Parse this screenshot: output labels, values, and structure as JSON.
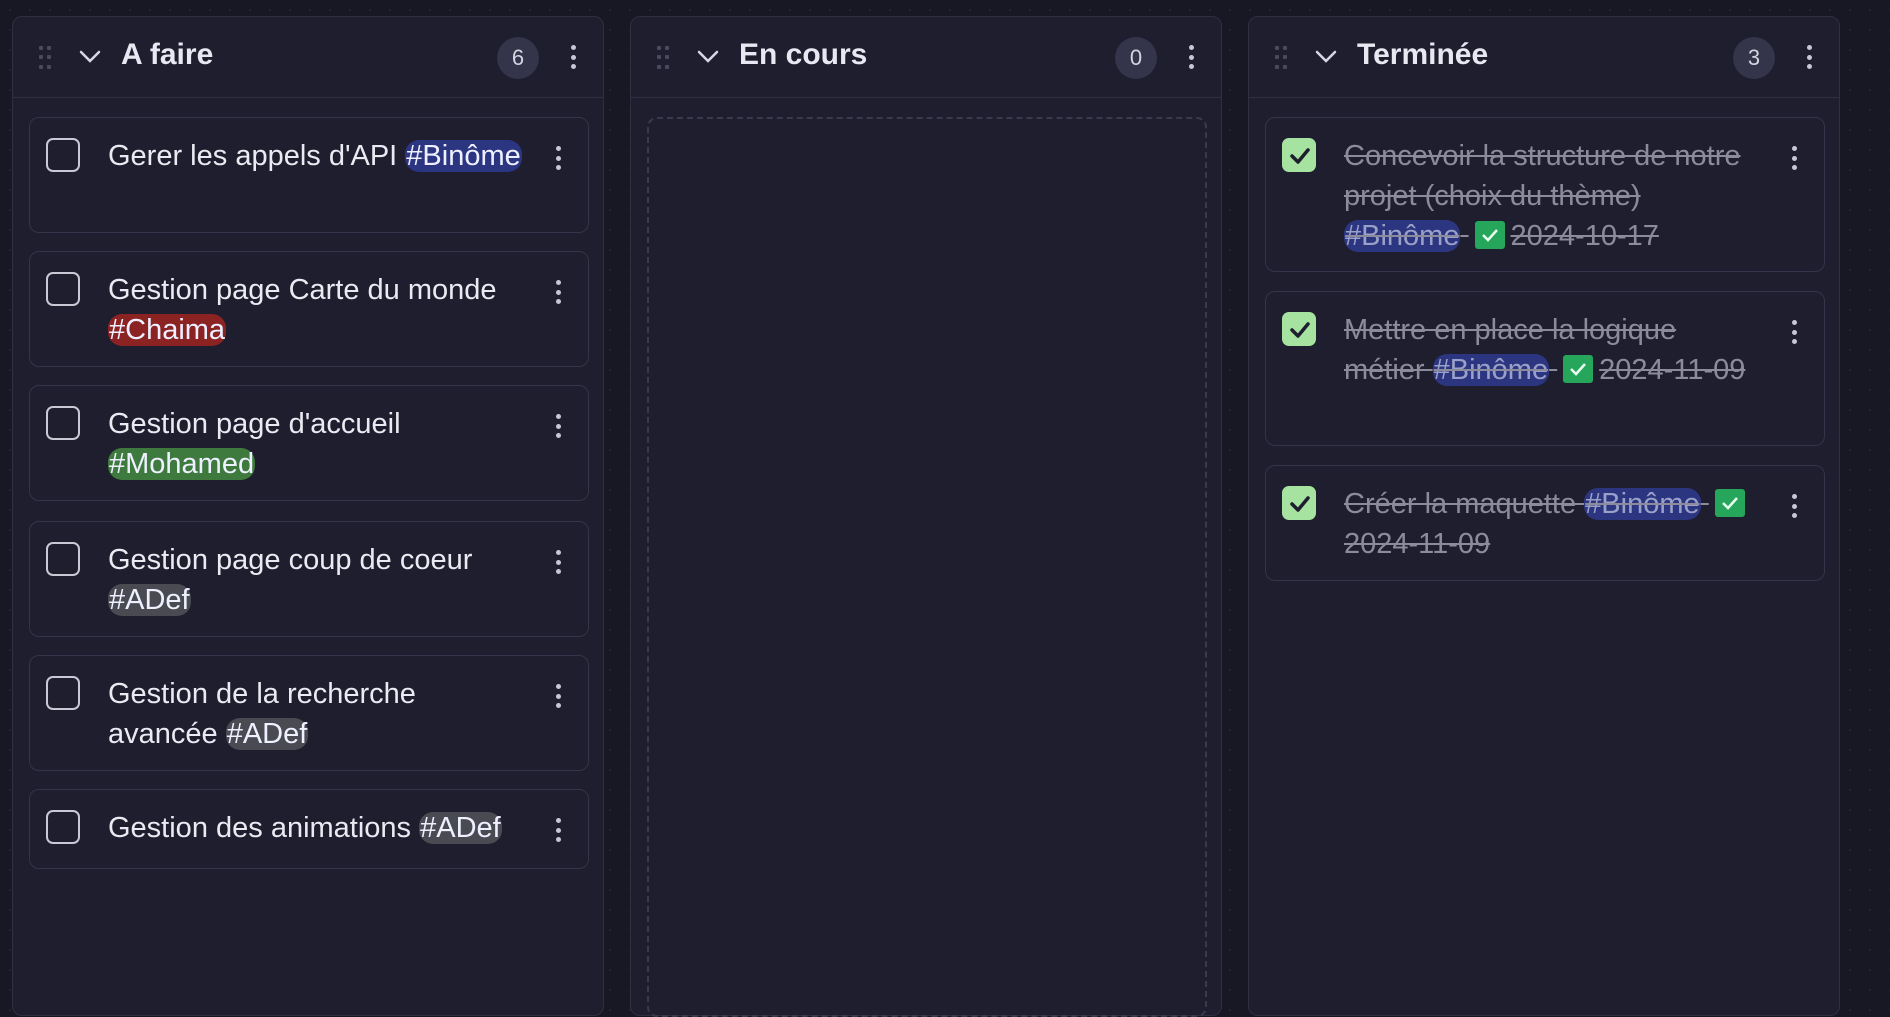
{
  "columns": [
    {
      "title": "A faire",
      "count": "6",
      "cards": [
        {
          "text": "Gerer les appels d'API ",
          "tag": "#Binôme"
        },
        {
          "text": "Gestion page Carte du monde ",
          "tag": "#Chaima"
        },
        {
          "text": "Gestion page d'accueil ",
          "tag": "#Mohamed"
        },
        {
          "text": "Gestion page coup de coeur ",
          "tag": "#ADef"
        },
        {
          "text": "Gestion de la recherche avancée ",
          "tag": "#ADef"
        },
        {
          "text": "Gestion des animations ",
          "tag": "#ADef"
        }
      ]
    },
    {
      "title": "En cours",
      "count": "0",
      "cards": []
    },
    {
      "title": "Terminée",
      "count": "3",
      "cards": [
        {
          "text": "Concevoir la structure de notre projet (choix du thème) ",
          "tag": "#Binôme",
          "date": "2024-10-17"
        },
        {
          "text": "Mettre en place la logique métier ",
          "tag": "#Binôme",
          "date": "2024-11-09"
        },
        {
          "text": "Créer la maquette ",
          "tag": "#Binôme",
          "date": "2024-11-09"
        }
      ]
    }
  ],
  "colors": {
    "background": "#181825",
    "column": "#1e1e2e",
    "tag_binome": "#2c3580",
    "tag_chaima": "#8b2323",
    "tag_mohamed": "#3e7a3e",
    "tag_adef": "#4a4a52",
    "checked": "#a6e3a1",
    "done_icon": "#26a65b"
  }
}
